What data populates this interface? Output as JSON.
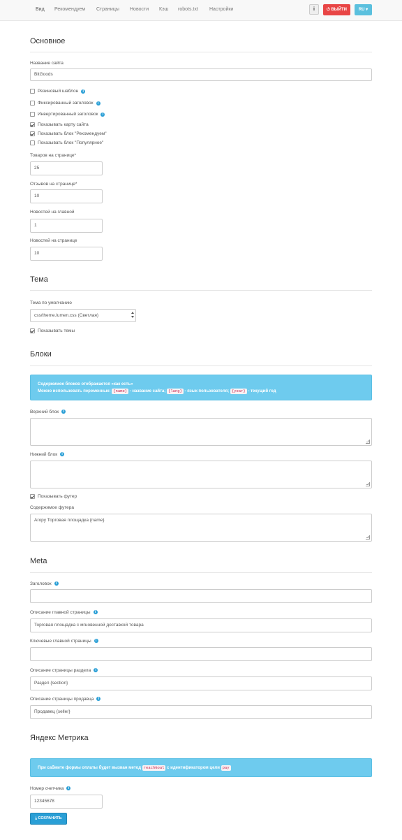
{
  "nav": {
    "items": [
      "Вид",
      "Рекомендуем",
      "Страницы",
      "Новости",
      "Кэш",
      "robots.txt",
      "Настройки"
    ],
    "info_label": "i",
    "logout_label": "Выйти",
    "lang_label": "RU"
  },
  "basic": {
    "title": "Основное",
    "site_name_label": "Название сайта",
    "site_name_value": "BitGoods",
    "options": [
      {
        "label": "Резиновый шаблон",
        "checked": false,
        "info": true
      },
      {
        "label": "Фиксированный заголовок",
        "checked": false,
        "info": true
      },
      {
        "label": "Инвертированный заголовок",
        "checked": false,
        "info": true
      },
      {
        "label": "Показывать карту сайта",
        "checked": true,
        "info": false
      },
      {
        "label": "Показывать блок \"Рекомендуем\"",
        "checked": true,
        "info": false
      },
      {
        "label": "Показывать блок \"Популярное\"",
        "checked": false,
        "info": false
      }
    ],
    "goods_per_page_label": "Товаров на странице*",
    "goods_per_page_value": "25",
    "reviews_per_page_label": "Отзывов на странице*",
    "reviews_per_page_value": "10",
    "news_on_main_label": "Новостей на главной",
    "news_on_main_value": "1",
    "news_per_page_label": "Новостей на странице",
    "news_per_page_value": "10"
  },
  "theme": {
    "title": "Тема",
    "default_label": "Тема по умолчанию",
    "default_value": "css/theme.lumen.css (Светлая)",
    "show_themes_label": "Показывать темы",
    "show_themes_checked": true
  },
  "blocks": {
    "title": "Блоки",
    "alert_line1": "Содержимое блоков отображается «как есть»",
    "alert_line2_prefix": "Можно использовать переменные:",
    "var_name": "{name}",
    "var_name_desc": "- название сайта;",
    "var_lang": "{lang}",
    "var_lang_desc": "- язык пользователя;",
    "var_year": "{year}",
    "var_year_desc": "- текущий год",
    "top_block_label": "Верхний блок",
    "bottom_block_label": "Нижний блок",
    "show_footer_label": "Показывать футер",
    "show_footer_checked": true,
    "footer_content_label": "Содержимое футера",
    "footer_content_value": "Агору Торговая площадка {name}"
  },
  "meta": {
    "title": "Meta",
    "heading_label": "Заголовок",
    "heading_value": "",
    "main_desc_label": "Описание главной страницы",
    "main_desc_value": "Торговая площадка с мгновенной доставкой товара",
    "main_keywords_label": "Ключевые главной страницы",
    "main_keywords_value": "",
    "section_desc_label": "Описание страницы раздела",
    "section_desc_value": "Раздел {section}",
    "seller_desc_label": "Описание страницы продавца",
    "seller_desc_value": "Продавец {seller}"
  },
  "metrika": {
    "title": "Яндекс Метрика",
    "alert_prefix": "При сабмите формы оплаты будет вызван метод",
    "alert_code1": "reachGoal",
    "alert_middle": "с идентификатором цели",
    "alert_code2": "pay",
    "counter_label": "Номер счетчика",
    "counter_value": "12345678",
    "save_label": "Сохранить"
  },
  "colors": {
    "accent": "#2a9fd6",
    "danger": "#e84545",
    "info": "#5bc0de",
    "alert_bg": "#6ecbee"
  }
}
